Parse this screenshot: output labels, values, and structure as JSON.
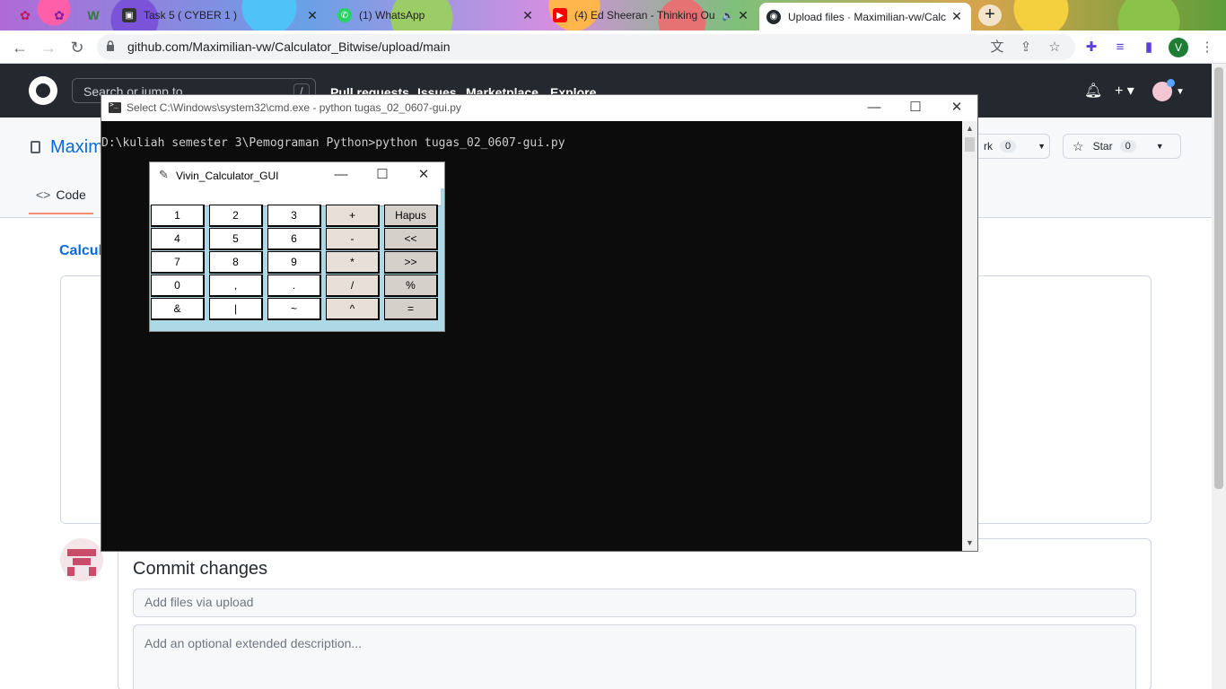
{
  "browser": {
    "pinned_tabs": [
      {
        "name": "pinned-tab-1",
        "glyph": "✿",
        "color": "#c2185b"
      },
      {
        "name": "pinned-tab-2",
        "glyph": "✿",
        "color": "#7b1fa2"
      },
      {
        "name": "pinned-tab-3",
        "glyph": "W",
        "color": "#2e7d32"
      }
    ],
    "tabs": [
      {
        "title": "Task 5 ( CYBER 1 )",
        "fav_color": "#333333",
        "fav_glyph": "▣"
      },
      {
        "title": "(1) WhatsApp",
        "fav_color": "#25d366",
        "fav_glyph": "✆"
      },
      {
        "title": "(4) Ed Sheeran - Thinking Ou",
        "fav_color": "#ff0000",
        "fav_glyph": "▶",
        "audio_icon": "🔈"
      },
      {
        "title": "Upload files · Maximilian-vw/Calc",
        "fav_color": "#24292f",
        "fav_glyph": "◉",
        "active": true
      }
    ],
    "close_glyph": "✕",
    "new_tab_glyph": "+",
    "url": "github.com/Maximilian-vw/Calculator_Bitwise/upload/main",
    "profile_initial": "V",
    "nav": {
      "back": "←",
      "forward": "→",
      "reload": "↻"
    }
  },
  "github": {
    "search_placeholder": "Search or jump to...",
    "search_kbd": "/",
    "nav": [
      "Pull requests",
      "Issues",
      "Marketplace",
      "Explore"
    ],
    "repo_owner_partial": "Maxim",
    "fork_label": "rk",
    "fork_count": "0",
    "star_label": "Star",
    "star_count": "0",
    "code_tab": "Code",
    "breadcrumb_partial": "Calcul",
    "commit": {
      "title": "Commit changes",
      "summary_placeholder": "Add files via upload",
      "description_placeholder": "Add an optional extended description..."
    }
  },
  "cmd": {
    "title": "Select C:\\Windows\\system32\\cmd.exe - python  tugas_02_0607-gui.py",
    "line": "D:\\kuliah semester 3\\Pemograman Python>python tugas_02_0607-gui.py"
  },
  "calculator": {
    "title": "Vivin_Calculator_GUI",
    "entry_value": "",
    "rows": [
      [
        "1",
        "2",
        "3",
        "+",
        "Hapus"
      ],
      [
        "4",
        "5",
        "6",
        "-",
        "<<"
      ],
      [
        "7",
        "8",
        "9",
        "*",
        ">>"
      ],
      [
        "0",
        ",",
        ".",
        "/",
        "%"
      ],
      [
        "&",
        "|",
        "~",
        "^",
        "="
      ]
    ]
  },
  "window_controls": {
    "minimize": "—",
    "maximize": "☐",
    "close": "✕"
  }
}
